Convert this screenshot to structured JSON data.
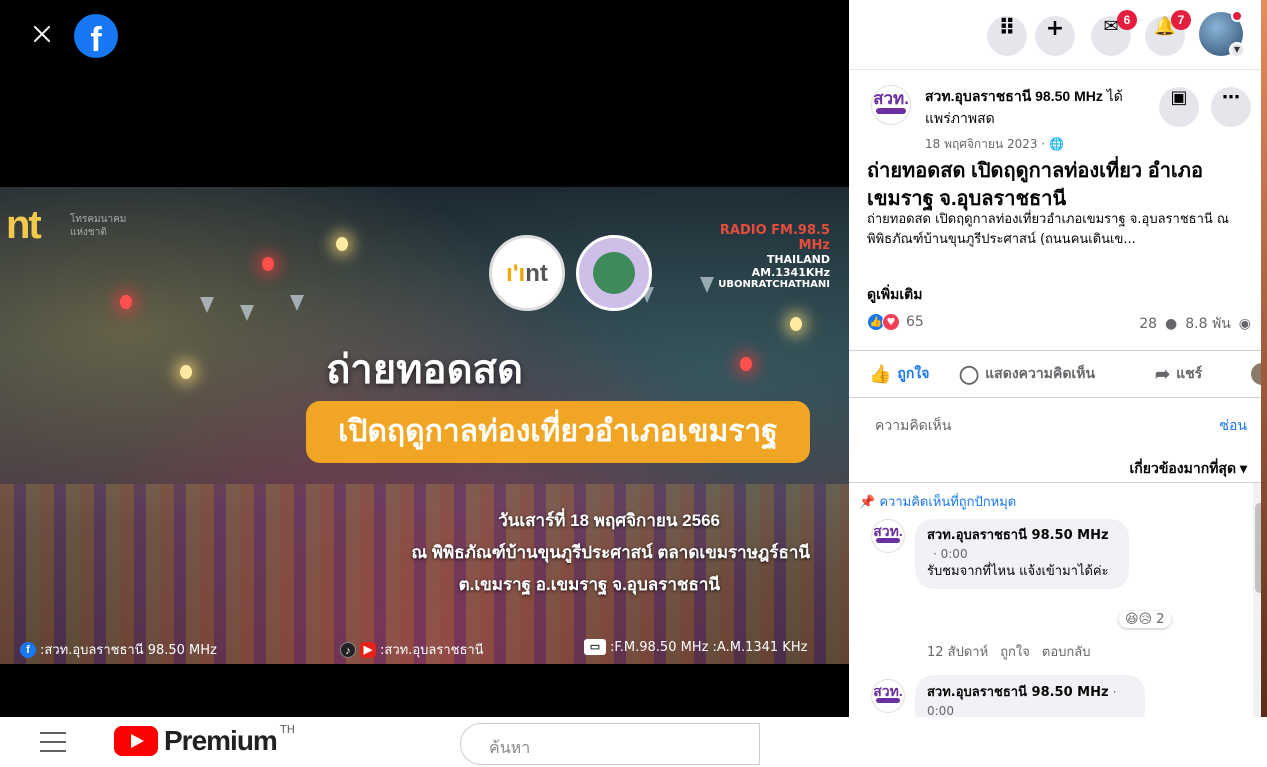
{
  "viewer": {
    "video": {
      "brand_left": "nt",
      "brand_left_sub": "โทรคมนาคม แห่งชาติ",
      "radio_line1": "RADIO FM.98.5 MHz",
      "radio_line2": "THAILAND AM.1341KHz",
      "radio_line3": "UBONRATCHATHANI",
      "nt_circle": "nt",
      "headline": "ถ่ายทอดสด",
      "subheadline": "เปิดฤดูกาลท่องเที่ยวอำเภอเขมราฐ",
      "info_1": "วันเสาร์ที่ 18 พฤศจิกายน 2566",
      "info_2": "ณ พิพิธภัณฑ์บ้านขุนภูรีประศาสน์ ตลาดเขมราษฎร์ธานี",
      "info_3": "ต.เขมราฐ อ.เขมราฐ จ.อุบลราชธานี",
      "bottom_fb": ":สวท.อุบลราชธานี 98.50 MHz",
      "bottom_social": ":สวท.อุบลราชธานี",
      "bottom_freq": ":F.M.98.50 MHz :A.M.1341 KHz"
    }
  },
  "fb": {
    "top_nav": {
      "messenger_badge": "6",
      "notifications_badge": "7"
    },
    "post": {
      "page_logo_text": "สวท.",
      "page_name": "สวท.อุบลราชธานี 98.50 MHz",
      "live_suffix": " ได้แพร่ภาพสด",
      "date": "18 พฤศจิกายน 2023 · 🌐",
      "title": "ถ่ายทอดสด เปิดฤดูกาลท่องเที่ยว อำเภอเขมราฐ จ.อุบลราชธานี",
      "description": "ถ่ายทอดสด เปิดฤดูกาลท่องเที่ยวอำเภอเขมราฐ จ.อุบลราชธานี ณ พิพิธภัณฑ์บ้านขุนภูรีประศาสน์ (ถนนคนเดินเข...",
      "see_more": "ดูเพิ่มเติม",
      "reaction_count": "65",
      "comment_count": "28",
      "view_count": "8.8 พัน"
    },
    "actions": {
      "like": "ถูกใจ",
      "comment": "แสดงความคิดเห็น",
      "share": "แชร์"
    },
    "comment_box": {
      "placeholder": "ความคิดเห็น",
      "hide": "ซ่อน",
      "sort": "เกี่ยวข้องมากที่สุด ▾"
    },
    "comments": {
      "pinned_label": "ความคิดเห็นที่ถูกปักหมุด",
      "items": [
        {
          "name": "สวท.อุบลราชธานี 98.50 MHz",
          "time": "· 0:00",
          "text": "รับชมจากที่ไหน แจ้งเข้ามาได้ค่ะ",
          "reaction_count": "2",
          "age": "12 สัปดาห์",
          "like": "ถูกใจ",
          "reply": "ตอบกลับ"
        },
        {
          "name": "สวท.อุบลราชธานี 98.50 MHz",
          "time": "· 0:00"
        }
      ]
    }
  },
  "youtube": {
    "logo_word": "Premium",
    "region": "TH",
    "search_placeholder": "ค้นหา"
  },
  "colors": {
    "fb_blue": "#1877f2",
    "badge_red": "#e41e3f",
    "orange_pill": "#f0a624",
    "yt_red": "#ff0000"
  },
  "icons": [
    "close-icon",
    "facebook-logo-icon",
    "apps-grid-icon",
    "plus-icon",
    "messenger-icon",
    "bell-icon",
    "save-icon",
    "more-icon",
    "like-icon",
    "comment-icon",
    "share-icon",
    "pin-icon",
    "hamburger-icon",
    "youtube-logo-icon"
  ]
}
